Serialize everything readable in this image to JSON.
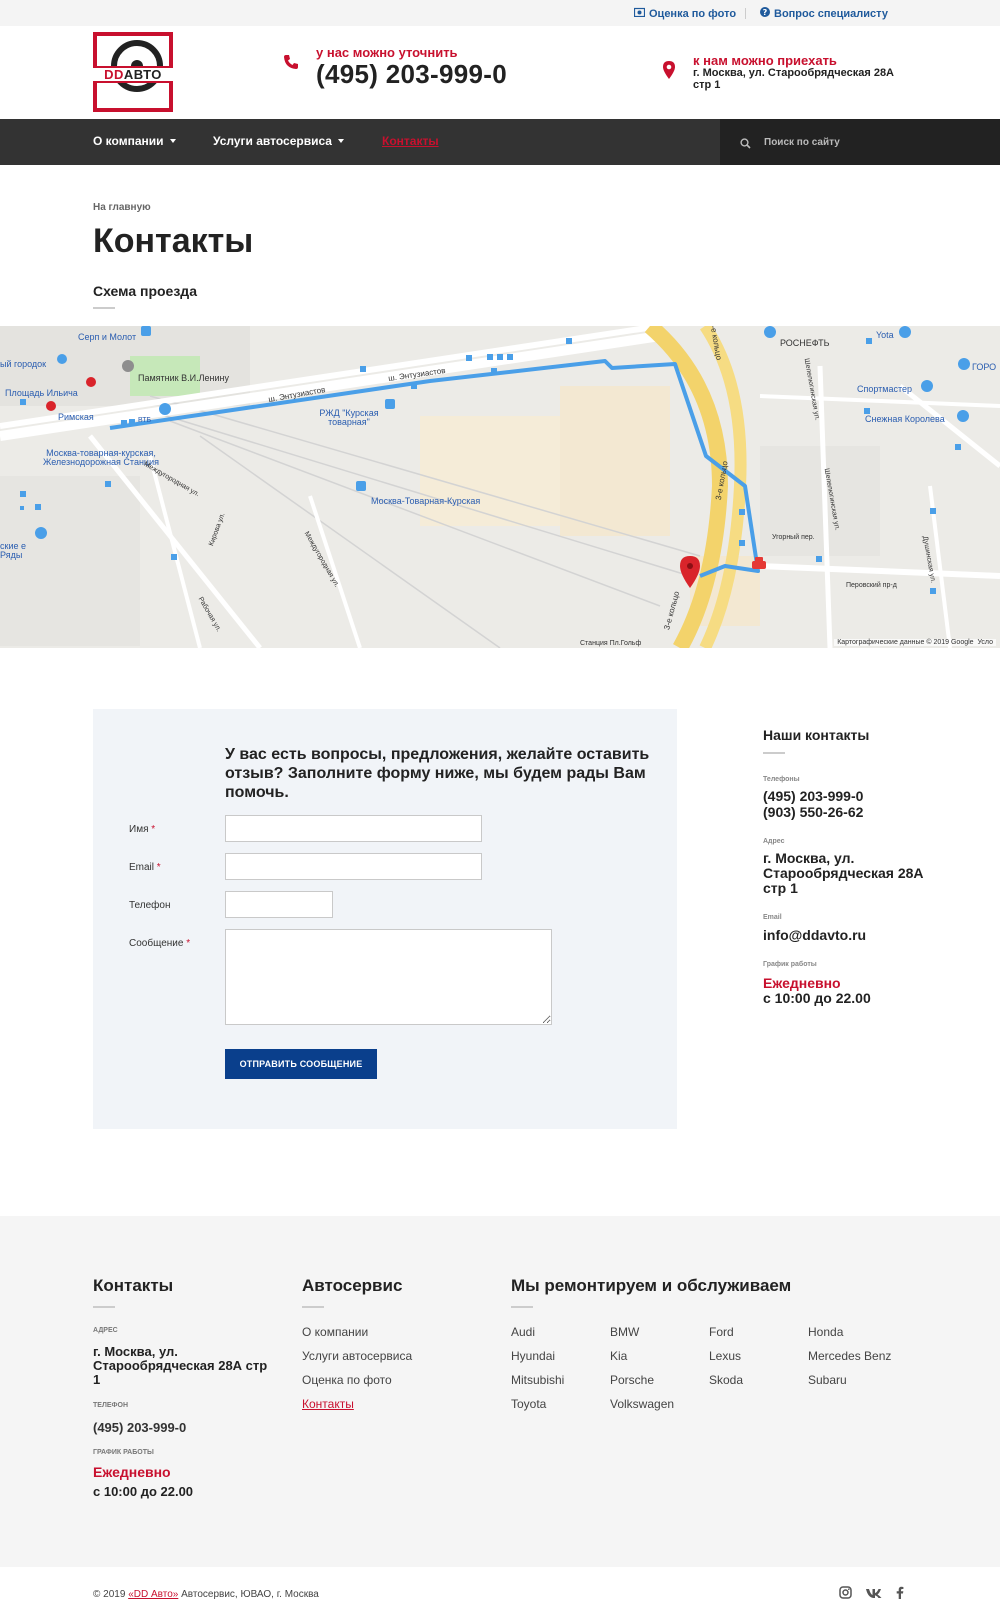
{
  "topbar": {
    "photo_eval": "Оценка по фото",
    "specialist_question": "Вопрос специалисту"
  },
  "logo": {
    "dd": "DD",
    "avto": "АВТО"
  },
  "header": {
    "phone_label": "у нас можно уточнить",
    "phone": "(495) 203-999-0",
    "address_label": "к нам можно приехать",
    "address": "г. Москва, ул. Старообрядческая 28А стр 1"
  },
  "nav": {
    "items": [
      {
        "label": "О компании"
      },
      {
        "label": "Услуги автосервиса"
      },
      {
        "label": "Контакты"
      }
    ],
    "search_placeholder": "Поиск по сайту"
  },
  "breadcrumb": "На главную",
  "page_title": "Контакты",
  "map_section_title": "Схема проезда",
  "map": {
    "labels": [
      "Серп и Молот",
      "ый городок",
      "Памятник В.И.Ленину",
      "Площадь Ильича",
      "Римская",
      "ВТБ",
      "ш. Энтузиастов",
      "ш. Энтузиастов",
      "РЖД \"Курская товарная\"",
      "Москва-товарная-курская, Железнодорожная Станция",
      "Москва-Товарная-Курская",
      "Междугородная ул.",
      "Рабочая ул.",
      "Кирова ул.",
      "Междугородная ул.",
      "ские е Ряды",
      "3-е кольцо",
      "3-е кольцо",
      "3-е кольцо",
      "РОСНЕФТЬ",
      "Yota",
      "ГОРО",
      "Спортмастер",
      "Снежная Королева",
      "Шепелюгинская ул.",
      "Шепелюгинская ул.",
      "Угорный пер.",
      "Перовский пр-д",
      "Душинская ул.",
      "Станция Пл.Гольф"
    ],
    "attribution": "Картографические данные © 2019 Google",
    "attribution_cut": "Усло"
  },
  "form": {
    "heading": "У вас есть вопросы, предложения, желайте оставить отзыв? Заполните форму ниже, мы будем рады Вам помочь.",
    "name_label": "Имя",
    "email_label": "Email",
    "phone_label": "Телефон",
    "message_label": "Сообщение",
    "required_mark": "*",
    "name_value": "",
    "email_value": "",
    "phone_value": "",
    "message_value": "",
    "submit_label": "ОТПРАВИТЬ СООБЩЕНИЕ"
  },
  "contacts": {
    "title": "Наши контакты",
    "phones_label": "Телефоны",
    "phone1": "(495) 203-999-0",
    "phone2": "(903) 550-26-62",
    "address_label": "Адрес",
    "address": "г. Москва, ул. Старообрядческая 28А стр 1",
    "email_label": "Email",
    "email": "info@ddavto.ru",
    "hours_label": "График работы",
    "hours_days": "Ежедневно",
    "hours_time": "с 10:00 до 22.00"
  },
  "footer": {
    "contacts_title": "Контакты",
    "address_label": "АДРЕС",
    "address": "г. Москва, ул. Старообрядческая 28А стр 1",
    "phone_label": "ТЕЛЕФОН",
    "phone": "(495) 203-999-0",
    "hours_label": "ГРАФИК РАБОТЫ",
    "hours_days": "Ежедневно",
    "hours_time": "с 10:00 до 22.00",
    "service_title": "Автосервис",
    "service_links": [
      "О компании",
      "Услуги автосервиса",
      "Оценка по фото",
      "Контакты"
    ],
    "brands_title": "Мы ремонтируем и обслуживаем",
    "brands": [
      "Audi",
      "BMW",
      "Ford",
      "Honda",
      "Hyundai",
      "Kia",
      "Lexus",
      "Mercedes Benz",
      "Mitsubishi",
      "Porsche",
      "Skoda",
      "Subaru",
      "Toyota",
      "Volkswagen"
    ],
    "copyright_prefix": "© 2019",
    "copyright_brand": "«DD Авто»",
    "copyright_suffix": "Автосервис, ЮВАО, г. Москва"
  },
  "colors": {
    "accent_red": "#c8102e",
    "nav_bg": "#333333",
    "button_blue": "#0a3f8c",
    "route_blue": "#4a9fe8"
  }
}
